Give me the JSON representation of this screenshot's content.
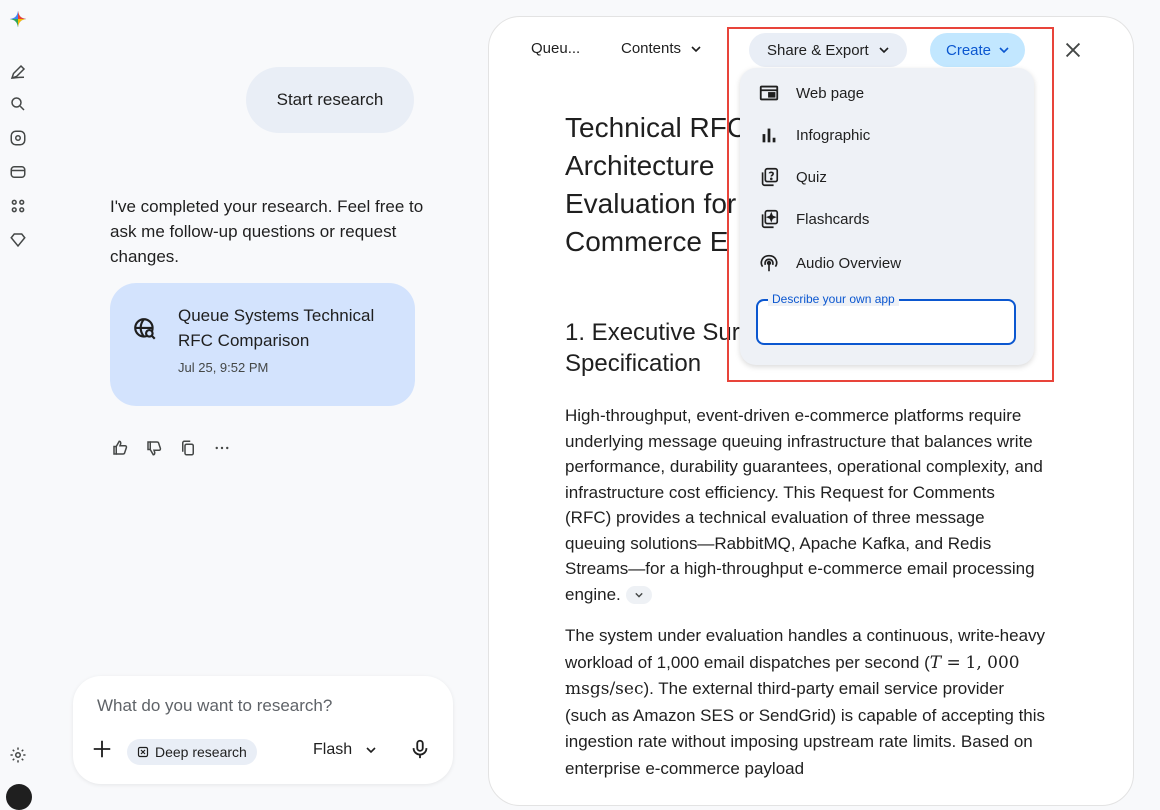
{
  "rail": {
    "icons": [
      "gemini-logo-icon",
      "new-chat-icon",
      "search-icon",
      "gem-icon",
      "library-icon",
      "apps-icon",
      "diamond-icon",
      "settings-icon"
    ]
  },
  "chat": {
    "user_message": "Start research",
    "assistant_reply": "I've completed your research. Feel free to ask me follow-up questions or request changes.",
    "doc_card": {
      "title": "Queue Systems Technical RFC Comparison",
      "date": "Jul 25, 9:52 PM"
    },
    "input": {
      "placeholder": "What do you want to research?",
      "chip_label": "Deep research",
      "model_label": "Flash"
    }
  },
  "doc": {
    "toolbar": {
      "title_short": "Queu...",
      "contents_label": "Contents",
      "share_label": "Share & Export",
      "create_label": "Create"
    },
    "title": "Technical RFC: Architecture & Evaluation for Commerce E",
    "title_lines": [
      "Technical RFC",
      "Architecture",
      "Evaluation for",
      "Commerce E"
    ],
    "h2_lines": [
      "1. Executive Sur",
      "Specification"
    ],
    "p1": "High-throughput, event-driven e-commerce platforms require underlying message queuing infrastructure that balances write performance, durability guarantees, operational complexity, and infrastructure cost efficiency. This Request for Comments (RFC) provides a technical evaluation of three message queuing solutions—RabbitMQ, Apache Kafka, and Redis Streams—for a high-throughput e-commerce email processing engine.",
    "p2_a": "The system under evaluation handles a continuous, write-heavy workload of 1,000 email dispatches per second (",
    "p2_math1": "T =",
    "p2_math2": "1, 000 msgs/sec",
    "p2_b": "). The external third-party email service provider (such as Amazon SES or SendGrid) is capable of accepting this ingestion rate without imposing upstream rate limits. Based on enterprise e-commerce payload"
  },
  "create_menu": {
    "items": [
      {
        "label": "Web page",
        "icon": "web-page-icon"
      },
      {
        "label": "Infographic",
        "icon": "infographic-icon"
      },
      {
        "label": "Quiz",
        "icon": "quiz-icon"
      },
      {
        "label": "Flashcards",
        "icon": "flashcards-icon"
      },
      {
        "label": "Audio Overview",
        "icon": "audio-overview-icon"
      }
    ],
    "app_field_label": "Describe your own app"
  },
  "colors": {
    "accent": "#0b57d0",
    "create_pill": "#c2e7ff",
    "card_bg": "#d3e3fd",
    "highlight": "#e8443a"
  }
}
